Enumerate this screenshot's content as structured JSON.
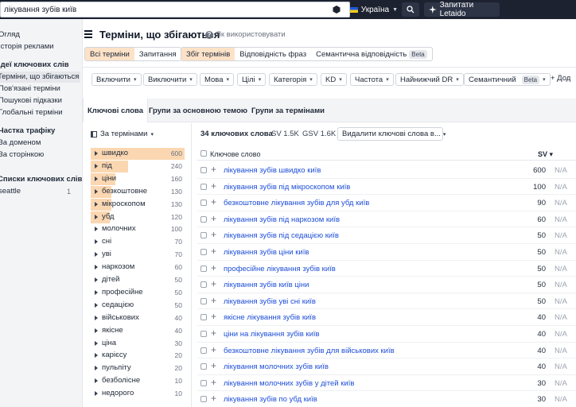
{
  "topbar": {
    "search_value": "лікування зубів київ",
    "country": "Україна",
    "ask_label": "Запитати Letaido"
  },
  "sidebar": {
    "items": [
      {
        "label": "Огляд",
        "type": "item"
      },
      {
        "label": "Історія реклами",
        "type": "item"
      },
      {
        "label": "Ідеї ключових слів",
        "type": "head"
      },
      {
        "label": "Терміни, що збігаються",
        "type": "active"
      },
      {
        "label": "Пов'язані терміни",
        "type": "item"
      },
      {
        "label": "Пошукові підказки",
        "type": "item"
      },
      {
        "label": "Глобальні терміни",
        "type": "item"
      },
      {
        "label": "Частка трафіку",
        "type": "head"
      },
      {
        "label": "За доменом",
        "type": "item"
      },
      {
        "label": "За сторінкою",
        "type": "item"
      },
      {
        "label": "Списки ключових слів",
        "type": "head"
      },
      {
        "label": "seattle",
        "type": "item",
        "count": "1"
      }
    ]
  },
  "header": {
    "title": "Терміни, що збігаються",
    "help": "Як використовувати"
  },
  "query_type": [
    "Всі терміни",
    "Запитання"
  ],
  "match_type": [
    "Збіг термінів",
    "Відповідність фраз",
    "Семантична відповідність"
  ],
  "beta_label": "Beta",
  "filters": [
    "Включити",
    "Виключити",
    "Мова",
    "Цілі",
    "Категорія",
    "KD",
    "Частота",
    "Найнижчий DR",
    "Семантичний"
  ],
  "add_filter": "+ Дод",
  "tabs": [
    "Ключові слова",
    "Групи за основною темою",
    "Групи за термінами"
  ],
  "group_selector": "За термінами",
  "groups": [
    {
      "label": "швидко",
      "count": "600"
    },
    {
      "label": "під",
      "count": "240"
    },
    {
      "label": "ціни",
      "count": "160"
    },
    {
      "label": "безкоштовне",
      "count": "130"
    },
    {
      "label": "мікроскопом",
      "count": "130"
    },
    {
      "label": "убд",
      "count": "120"
    },
    {
      "label": "молочних",
      "count": "100"
    },
    {
      "label": "сні",
      "count": "70"
    },
    {
      "label": "уві",
      "count": "70"
    },
    {
      "label": "наркозом",
      "count": "60"
    },
    {
      "label": "дітей",
      "count": "50"
    },
    {
      "label": "професійне",
      "count": "50"
    },
    {
      "label": "седацією",
      "count": "50"
    },
    {
      "label": "військових",
      "count": "40"
    },
    {
      "label": "якісне",
      "count": "40"
    },
    {
      "label": "ціна",
      "count": "30"
    },
    {
      "label": "карієсу",
      "count": "20"
    },
    {
      "label": "пульпіту",
      "count": "20"
    },
    {
      "label": "безболісне",
      "count": "10"
    },
    {
      "label": "недорого",
      "count": "10"
    }
  ],
  "table": {
    "count_label": "34 ключових слова",
    "sv_label": "SV 1.5K",
    "gsv_label": "GSV 1.6K",
    "delete_label": "Видалити ключові слова в...",
    "col_keyword": "Ключове слово",
    "col_sv": "SV",
    "rows": [
      {
        "keyword": "лікування зубів швидко київ",
        "sv": "600",
        "extra": "N/A"
      },
      {
        "keyword": "лікування зубів під мікроскопом київ",
        "sv": "100",
        "extra": "N/A"
      },
      {
        "keyword": "безкоштовне лікування зубів для убд київ",
        "sv": "90",
        "extra": "N/A"
      },
      {
        "keyword": "лікування зубів під наркозом київ",
        "sv": "60",
        "extra": "N/A"
      },
      {
        "keyword": "лікування зубів під седацією київ",
        "sv": "50",
        "extra": "N/A"
      },
      {
        "keyword": "лікування зубів ціни київ",
        "sv": "50",
        "extra": "N/A"
      },
      {
        "keyword": "професійне лікування зубів київ",
        "sv": "50",
        "extra": "N/A"
      },
      {
        "keyword": "лікування зубів київ ціни",
        "sv": "50",
        "extra": "N/A"
      },
      {
        "keyword": "лікування зубів уві сні київ",
        "sv": "50",
        "extra": "N/A"
      },
      {
        "keyword": "якісне лікування зубів київ",
        "sv": "40",
        "extra": "N/A"
      },
      {
        "keyword": "ціни на лікування зубів київ",
        "sv": "40",
        "extra": "N/A"
      },
      {
        "keyword": "безкоштовне лікування зубів для військових київ",
        "sv": "40",
        "extra": "N/A"
      },
      {
        "keyword": "лікування молочних зубів київ",
        "sv": "40",
        "extra": "N/A"
      },
      {
        "keyword": "лікування молочних зубів у дітей київ",
        "sv": "30",
        "extra": "N/A"
      },
      {
        "keyword": "лікування зубів по убд київ",
        "sv": "30",
        "extra": "N/A"
      }
    ]
  }
}
